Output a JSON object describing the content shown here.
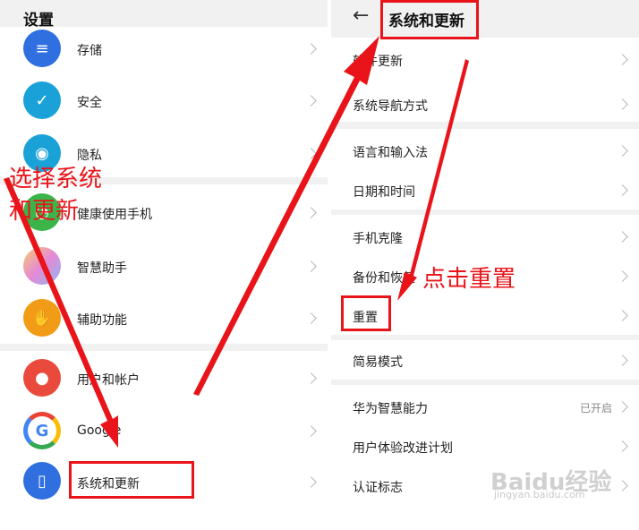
{
  "left": {
    "title": "设置",
    "items": [
      {
        "label": "存储",
        "icon": "storage-icon",
        "color": "#2f6fe0"
      },
      {
        "label": "安全",
        "icon": "shield-icon",
        "color": "#1aa2d8"
      },
      {
        "label": "隐私",
        "icon": "privacy-icon",
        "color": "#1aa2d8"
      },
      {
        "label": "健康使用手机",
        "icon": "health-icon",
        "color": "#3bb54a"
      },
      {
        "label": "智慧助手",
        "icon": "assistant-icon",
        "color": "#d98cd4"
      },
      {
        "label": "辅助功能",
        "icon": "hand-icon",
        "color": "#f29b16"
      },
      {
        "label": "用户和帐户",
        "icon": "user-icon",
        "color": "#ea4a3c"
      },
      {
        "label": "Google",
        "icon": "google-icon",
        "color": "#ffffff"
      },
      {
        "label": "系统和更新",
        "icon": "phone-icon",
        "color": "#2f6fe0"
      }
    ]
  },
  "right": {
    "title": "系统和更新",
    "items": [
      {
        "label": "软件更新"
      },
      {
        "label": "系统导航方式"
      },
      {
        "label": "语言和输入法"
      },
      {
        "label": "日期和时间"
      },
      {
        "label": "手机克隆"
      },
      {
        "label": "备份和恢复"
      },
      {
        "label": "重置"
      },
      {
        "label": "简易模式"
      },
      {
        "label": "华为智慧能力",
        "value": "已开启"
      },
      {
        "label": "用户体验改进计划"
      },
      {
        "label": "认证标志"
      }
    ]
  },
  "annotations": {
    "left_text_line1": "选择系统",
    "left_text_line2": "和更新",
    "right_text": "点击重置",
    "color": "#e8141a"
  },
  "watermark": {
    "brand": "Baidu经验",
    "url": "jingyan.baidu.com"
  }
}
